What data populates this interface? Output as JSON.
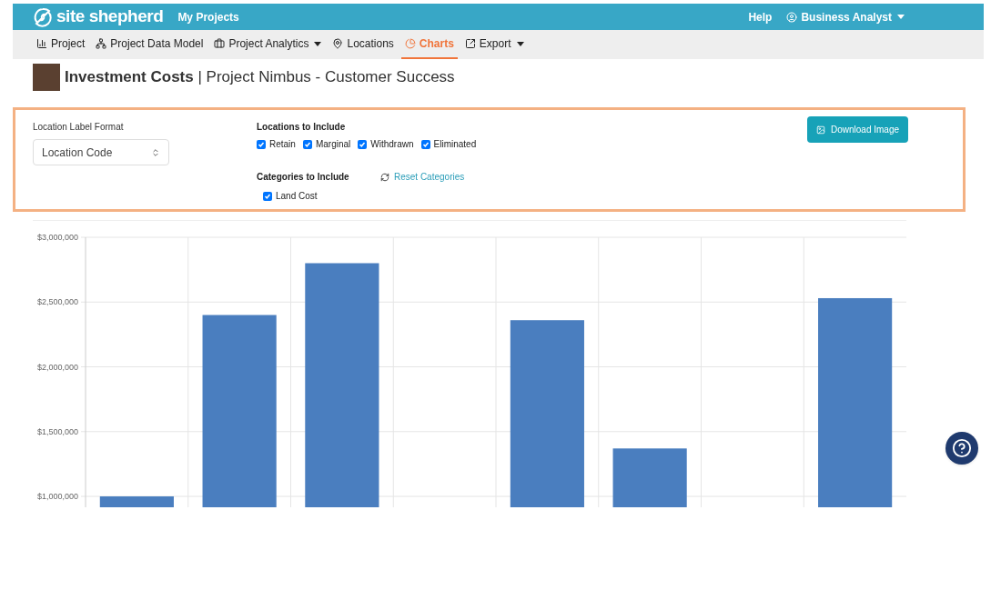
{
  "header": {
    "brand": "site shepherd",
    "links": [
      {
        "label": "My Projects"
      }
    ],
    "right": [
      {
        "kind": "link",
        "label": "Help"
      },
      {
        "kind": "user",
        "label": "Business Analyst"
      }
    ]
  },
  "nav": [
    {
      "label": "Project",
      "dropdown": false,
      "selected": false
    },
    {
      "label": "Project Data Model",
      "dropdown": false,
      "selected": false
    },
    {
      "label": "Project Analytics",
      "dropdown": true,
      "selected": false
    },
    {
      "label": "Locations",
      "dropdown": false,
      "selected": false
    },
    {
      "label": "Charts",
      "dropdown": false,
      "selected": true
    },
    {
      "label": "Export",
      "dropdown": true,
      "selected": false
    }
  ],
  "title": {
    "main": "Investment Costs",
    "separator": "|",
    "sub": "Project Nimbus - Customer Success"
  },
  "controls": {
    "label_format": {
      "label": "Location Label Format",
      "value": "Location Code"
    },
    "locations": {
      "heading": "Locations to Include",
      "options": [
        {
          "label": "Retain",
          "checked": true
        },
        {
          "label": "Marginal",
          "checked": true
        },
        {
          "label": "Withdrawn",
          "checked": true
        },
        {
          "label": "Eliminated",
          "checked": true
        }
      ]
    },
    "categories": {
      "heading": "Categories to Include",
      "reset": "Reset Categories",
      "options": [
        {
          "label": "Land Cost",
          "checked": true
        }
      ]
    },
    "download": "Download Image"
  },
  "chart_data": {
    "type": "bar",
    "grid": true,
    "values": [
      1000000,
      2400000,
      2800000,
      null,
      2360000,
      1370000,
      null,
      2530000
    ],
    "ylim": [
      916000,
      3000000
    ],
    "yticks": [
      {
        "value": 1000000,
        "label": "$1,000,000"
      },
      {
        "value": 1500000,
        "label": "$1,500,000"
      },
      {
        "value": 2000000,
        "label": "$2,000,000"
      },
      {
        "value": 2500000,
        "label": "$2,500,000"
      },
      {
        "value": 3000000,
        "label": "$3,000,000"
      }
    ]
  }
}
